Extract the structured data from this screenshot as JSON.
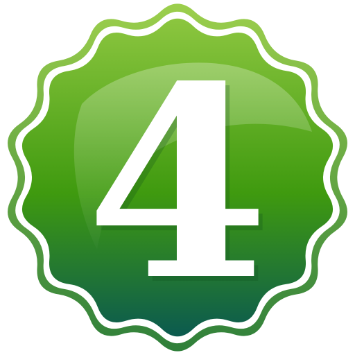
{
  "badge": {
    "number": "4",
    "colors": {
      "top": "#8cc63f",
      "mid": "#3f9a0f",
      "bottom": "#0b5a4f",
      "outer_ring": "#5fae2a",
      "rim": "#ffffff",
      "numeral": "#ffffff"
    }
  }
}
